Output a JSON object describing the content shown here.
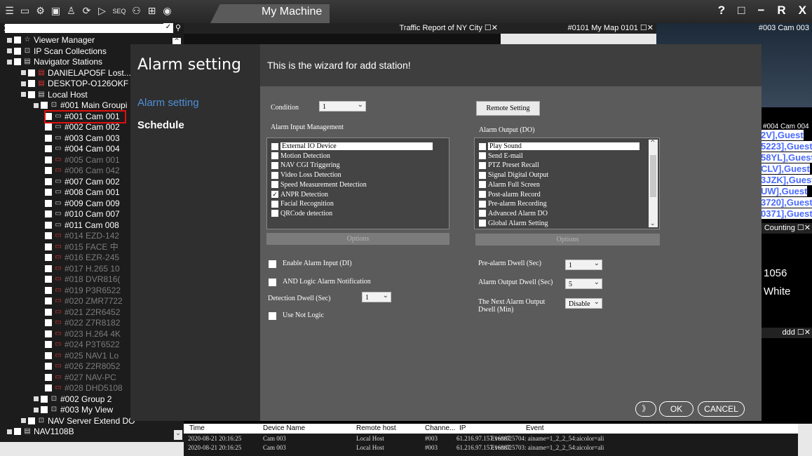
{
  "window": {
    "title": "My Machine",
    "controls": [
      "?",
      "□",
      "−",
      "R",
      "X"
    ]
  },
  "toolbar": {
    "icons": [
      "menu-icon",
      "monitor-icon",
      "settings-icon",
      "display-icon",
      "person-icon",
      "refresh-icon",
      "play-icon",
      "seq-icon",
      "people-icon",
      "grid-icon",
      "camera-icon"
    ],
    "seq_label": "SEQ"
  },
  "tree": {
    "items": [
      {
        "label": "Viewer Manager",
        "icon": "star-icon",
        "depth": 0,
        "dim": false
      },
      {
        "label": "IP Scan Collections",
        "icon": "group-icon",
        "depth": 0,
        "dim": false
      },
      {
        "label": "Navigator Stations",
        "icon": "server-icon",
        "depth": 0,
        "dim": false
      },
      {
        "label": "DANIELAPO5F Lost...",
        "icon": "server-red-icon",
        "depth": 1,
        "dim": false
      },
      {
        "label": "DESKTOP-O126OKF L",
        "icon": "server-red-icon",
        "depth": 1,
        "dim": false
      },
      {
        "label": "Local Host",
        "icon": "server-icon",
        "depth": 1,
        "dim": false
      },
      {
        "label": "#001 Main Groupi",
        "icon": "group-icon",
        "depth": 2,
        "dim": false
      },
      {
        "label": "#001 Cam 001",
        "icon": "camera-icon",
        "depth": 3,
        "dim": false
      },
      {
        "label": "#002 Cam 002",
        "icon": "camera-icon",
        "depth": 3,
        "dim": false
      },
      {
        "label": "#003 Cam 003",
        "icon": "camera-icon",
        "depth": 3,
        "dim": false
      },
      {
        "label": "#004 Cam 004",
        "icon": "camera-icon",
        "depth": 3,
        "dim": false
      },
      {
        "label": "#005 Cam 001",
        "icon": "camera-red-icon",
        "depth": 3,
        "dim": true
      },
      {
        "label": "#006 Cam 042",
        "icon": "camera-red-icon",
        "depth": 3,
        "dim": true
      },
      {
        "label": "#007 Cam 002",
        "icon": "camera-icon",
        "depth": 3,
        "dim": false
      },
      {
        "label": "#008 Cam 001",
        "icon": "camera-icon",
        "depth": 3,
        "dim": false
      },
      {
        "label": "#009 Cam 009",
        "icon": "camera-icon",
        "depth": 3,
        "dim": false
      },
      {
        "label": "#010 Cam 007",
        "icon": "camera-icon",
        "depth": 3,
        "dim": false
      },
      {
        "label": "#011 Cam 008",
        "icon": "camera-icon",
        "depth": 3,
        "dim": false
      },
      {
        "label": "#014 EZD-142",
        "icon": "camera-red-icon",
        "depth": 3,
        "dim": true
      },
      {
        "label": "#015 FACE 中",
        "icon": "camera-red-icon",
        "depth": 3,
        "dim": true
      },
      {
        "label": "#016 EZR-245",
        "icon": "camera-red-icon",
        "depth": 3,
        "dim": true
      },
      {
        "label": "#017 H.265 10",
        "icon": "camera-red-icon",
        "depth": 3,
        "dim": true
      },
      {
        "label": "#018 DVR816(",
        "icon": "camera-red-icon",
        "depth": 3,
        "dim": true
      },
      {
        "label": "#019 P3R6522",
        "icon": "camera-red-icon",
        "depth": 3,
        "dim": true
      },
      {
        "label": "#020 ZMR7722",
        "icon": "camera-red-icon",
        "depth": 3,
        "dim": true
      },
      {
        "label": "#021 Z2R6452",
        "icon": "camera-red-icon",
        "depth": 3,
        "dim": true
      },
      {
        "label": "#022 Z7R8182",
        "icon": "camera-red-icon",
        "depth": 3,
        "dim": true
      },
      {
        "label": "#023 H.264 4K",
        "icon": "camera-red-icon",
        "depth": 3,
        "dim": true
      },
      {
        "label": "#024 P3T6522",
        "icon": "camera-red-icon",
        "depth": 3,
        "dim": true
      },
      {
        "label": "#025 NAV1 Lo",
        "icon": "camera-red-icon",
        "depth": 3,
        "dim": true
      },
      {
        "label": "#026 Z2R8052",
        "icon": "camera-red-icon",
        "depth": 3,
        "dim": true
      },
      {
        "label": "#027 NAV-PC",
        "icon": "camera-red-icon",
        "depth": 3,
        "dim": true
      },
      {
        "label": "#028 DHD5108",
        "icon": "camera-red-icon",
        "depth": 3,
        "dim": true
      },
      {
        "label": "#002 Group 2",
        "icon": "group-icon",
        "depth": 2,
        "dim": false
      },
      {
        "label": "#003 My View",
        "icon": "group-icon",
        "depth": 2,
        "dim": false
      },
      {
        "label": "NAV Server Extend DO",
        "icon": "group-icon",
        "depth": 1,
        "dim": false
      },
      {
        "label": "NAV1108B",
        "icon": "server-icon",
        "depth": 0,
        "dim": false
      }
    ],
    "search_value": "",
    "selected": "#001 Cam 001"
  },
  "panels": {
    "traffic": "Traffic Report of NY City",
    "map": "#0101 My Map 0101",
    "cam003": "#003 Cam 003",
    "cam004": "#004 Cam 004",
    "counting": "Counting",
    "ddd": "ddd",
    "plate": "1056",
    "color": "White",
    "guests": [
      "2V],Guest",
      "5223],Guest",
      "58YL],Guest",
      "CLV],Guest",
      "3JZK],Guest",
      "UW],Guest",
      "3720],Guest",
      "0371],Guest"
    ]
  },
  "dialog": {
    "title": "Alarm setting",
    "wizard_text": "This is the wizard for add station!",
    "nav": [
      "Alarm setting",
      "Schedule"
    ],
    "condition_label": "Condition",
    "condition_value": "1",
    "remote_setting": "Remote Setting",
    "input_title": "Alarm Input Management",
    "input_items": [
      {
        "label": "External IO Device",
        "checked": false
      },
      {
        "label": "Motion Detection",
        "checked": false
      },
      {
        "label": "NAV CGI Triggering",
        "checked": false
      },
      {
        "label": "Video Loss Detection",
        "checked": false
      },
      {
        "label": "Speed Measurement Detection",
        "checked": false
      },
      {
        "label": "ANPR Detection",
        "checked": true
      },
      {
        "label": "Facial Recognition",
        "checked": false
      },
      {
        "label": "QRCode detection",
        "checked": false
      }
    ],
    "output_title": "Alarm Output (DO)",
    "output_items": [
      {
        "label": "Play Sound",
        "checked": false
      },
      {
        "label": "Send E-mail",
        "checked": false
      },
      {
        "label": "PTZ Preset Recall",
        "checked": false
      },
      {
        "label": "Signal Digital Output",
        "checked": false
      },
      {
        "label": "Alarm Full Screen",
        "checked": false
      },
      {
        "label": "Post-alarm Record",
        "checked": false
      },
      {
        "label": "Pre-alarm Recording",
        "checked": false
      },
      {
        "label": "Advanced Alarm DO",
        "checked": false
      },
      {
        "label": "Global Alarm Setting",
        "checked": false
      }
    ],
    "options_label": "Options",
    "enable_di": "Enable Alarm Input (DI)",
    "and_logic": "AND Logic Alarm Notification",
    "detection_dwell": "Detection Dwell (Sec)",
    "detection_dwell_value": "1",
    "use_not_logic": "Use Not Logic",
    "prealarm_dwell": "Pre-alarm Dwell (Sec)",
    "prealarm_value": "1",
    "output_dwell": "Alarm Output Dwell (Sec)",
    "output_dwell_value": "5",
    "next_output_l1": "The Next Alarm Output",
    "next_output_l2": "Dwell (Min)",
    "next_output_value": "Disable",
    "next_button": "》",
    "ok": "OK",
    "cancel": "CANCEL"
  },
  "log": {
    "headers": [
      "Time",
      "Device Name",
      "Remote host",
      "Channe...",
      "IP",
      "Event"
    ],
    "rows": [
      [
        "2020-08-21 20:16:25",
        "Cam 003",
        "Local Host",
        "#003",
        "61.216.97.157:16887",
        "Event025704: ainame=1_2_2_54:aicolor=ali"
      ],
      [
        "2020-08-21 20:16:25",
        "Cam 003",
        "Local Host",
        "#003",
        "61.216.97.157:16887",
        "Event025703: ainame=1_2_2_54:aicolor=ali"
      ]
    ]
  }
}
